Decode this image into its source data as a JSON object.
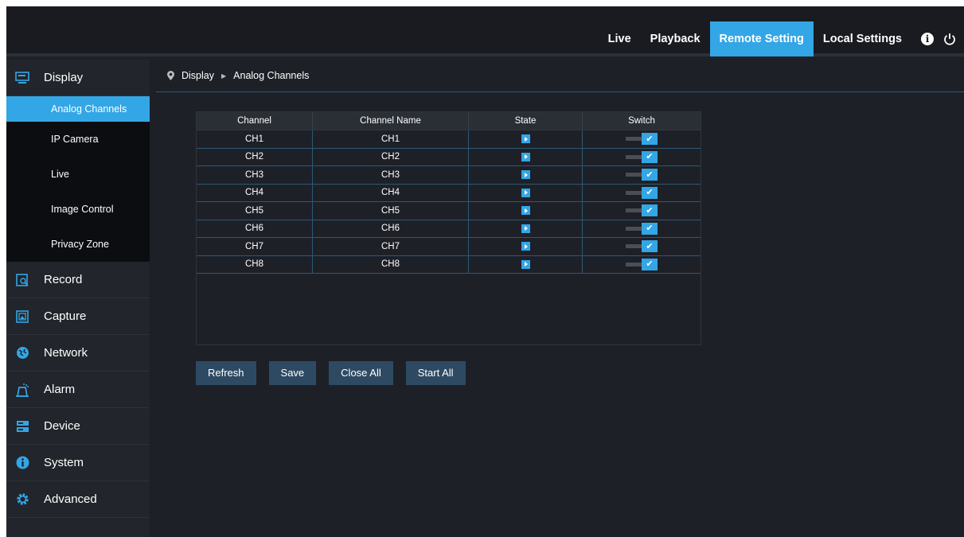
{
  "nav": {
    "items": [
      {
        "label": "Live",
        "active": false
      },
      {
        "label": "Playback",
        "active": false
      },
      {
        "label": "Remote Setting",
        "active": true
      },
      {
        "label": "Local Settings",
        "active": false
      }
    ],
    "icons": [
      "info-icon",
      "power-icon"
    ]
  },
  "sidebar": {
    "sections": [
      {
        "label": "Display",
        "icon": "monitor-icon"
      },
      {
        "label": "Record",
        "icon": "record-icon"
      },
      {
        "label": "Capture",
        "icon": "capture-icon"
      },
      {
        "label": "Network",
        "icon": "network-icon"
      },
      {
        "label": "Alarm",
        "icon": "alarm-icon"
      },
      {
        "label": "Device",
        "icon": "device-icon"
      },
      {
        "label": "System",
        "icon": "system-info-icon"
      },
      {
        "label": "Advanced",
        "icon": "gear-icon"
      }
    ],
    "display_sub": [
      {
        "label": "Analog Channels",
        "active": true
      },
      {
        "label": "IP Camera",
        "active": false
      },
      {
        "label": "Live",
        "active": false
      },
      {
        "label": "Image Control",
        "active": false
      },
      {
        "label": "Privacy Zone",
        "active": false
      }
    ]
  },
  "breadcrumb": {
    "root": "Display",
    "current": "Analog Channels"
  },
  "table": {
    "headers": [
      "Channel",
      "Channel Name",
      "State",
      "Switch"
    ],
    "rows": [
      {
        "channel": "CH1",
        "name": "CH1",
        "switch_on": true
      },
      {
        "channel": "CH2",
        "name": "CH2",
        "switch_on": true
      },
      {
        "channel": "CH3",
        "name": "CH3",
        "switch_on": true
      },
      {
        "channel": "CH4",
        "name": "CH4",
        "switch_on": true
      },
      {
        "channel": "CH5",
        "name": "CH5",
        "switch_on": true
      },
      {
        "channel": "CH6",
        "name": "CH6",
        "switch_on": true
      },
      {
        "channel": "CH7",
        "name": "CH7",
        "switch_on": true
      },
      {
        "channel": "CH8",
        "name": "CH8",
        "switch_on": true
      }
    ]
  },
  "buttons": {
    "refresh": "Refresh",
    "save": "Save",
    "close_all": "Close All",
    "start_all": "Start All"
  },
  "colors": {
    "accent": "#33a6e6",
    "background": "#1e2027",
    "button": "#2e4a63"
  }
}
